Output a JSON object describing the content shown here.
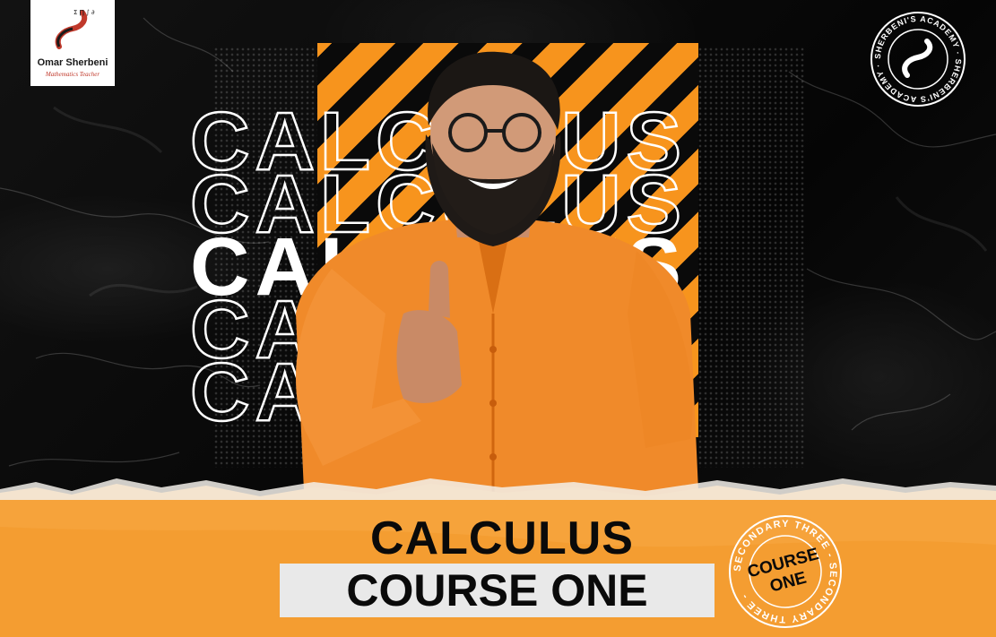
{
  "logo": {
    "name": "Omar Sherbeni",
    "tagline": "Mathematics Teacher",
    "symbols": "Σ ∏ ∫ ∂ ∅"
  },
  "academy_badge": {
    "text": "SHERBENI'S ACADEMY · SHERBENI'S ACADEMY ·"
  },
  "background_words": {
    "word": "CALCULUS"
  },
  "title": {
    "line1": "CALCULUS",
    "line2": "COURSE ONE"
  },
  "course_badge": {
    "ring_text": "SECONDARY THREE - SECONDARY THREE - ",
    "line1": "COURSE",
    "line2": "ONE"
  },
  "colors": {
    "accent_orange": "#f7941d",
    "background": "#0b0b0b",
    "text_dark": "#0a0a0a",
    "text_light": "#ffffff"
  },
  "icons": {
    "logo": "pencil-s-logo-icon",
    "academy": "academy-seal-icon"
  }
}
